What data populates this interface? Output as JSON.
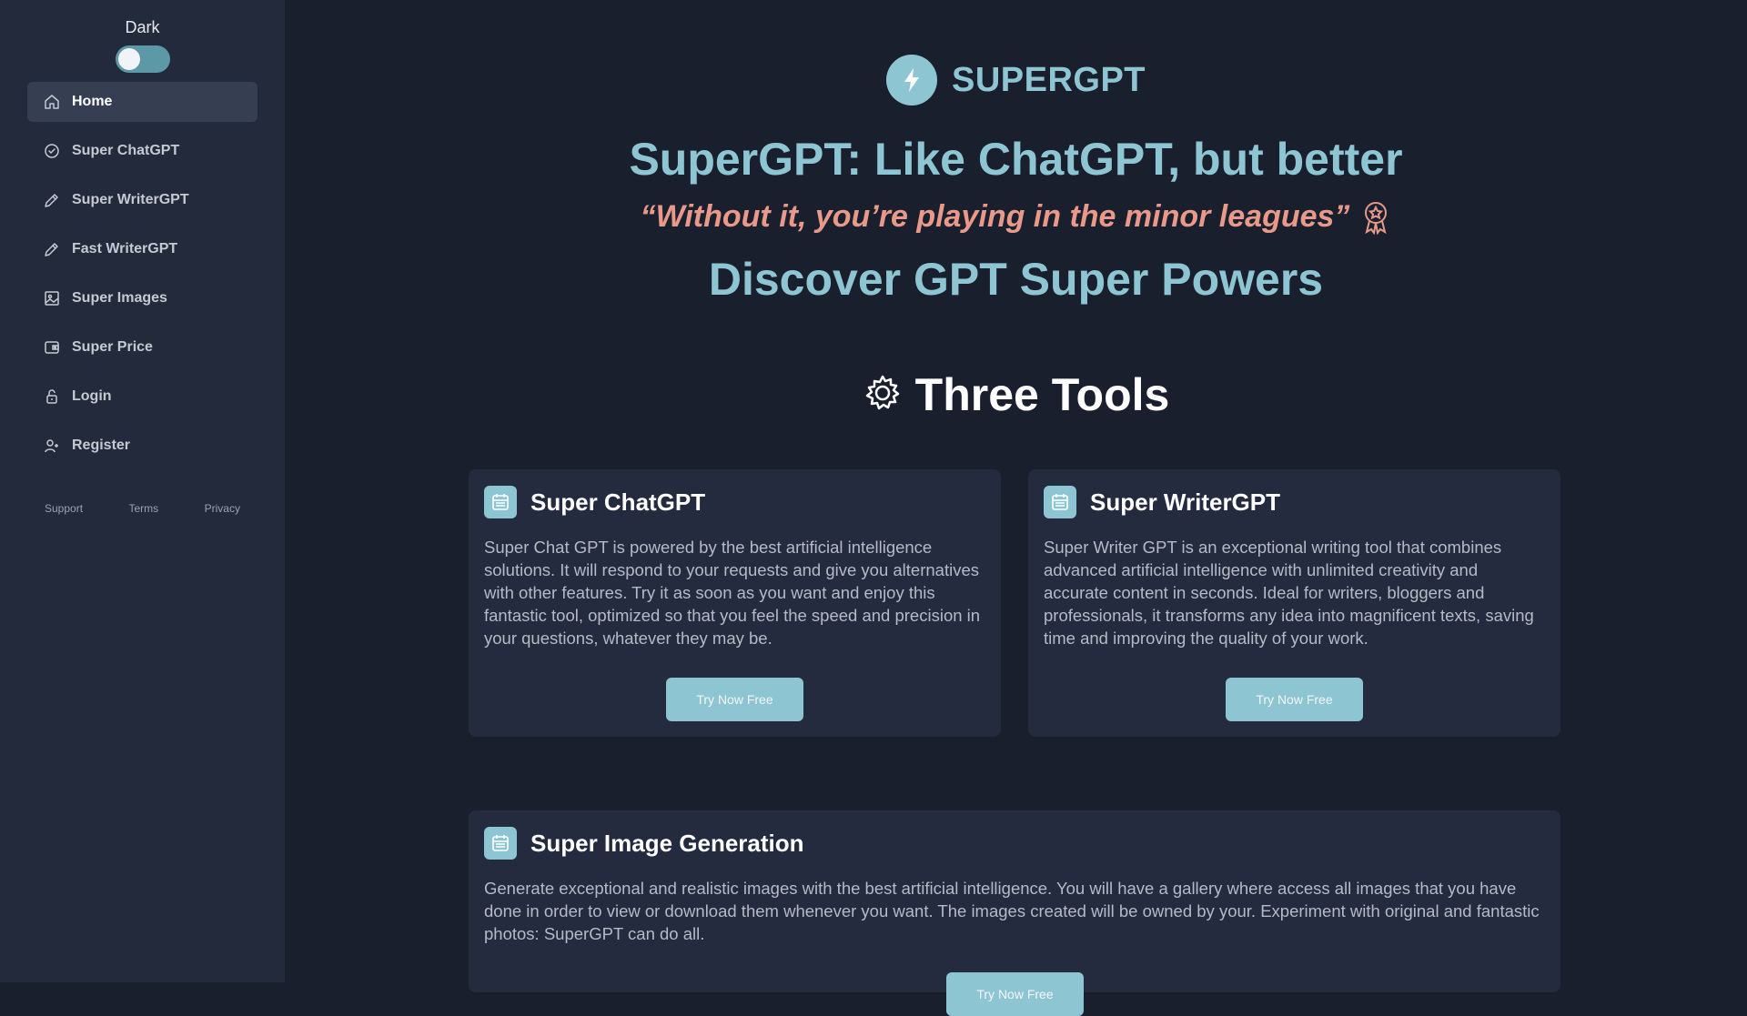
{
  "sidebar": {
    "theme_label": "Dark",
    "items": [
      {
        "label": "Home",
        "icon": "home-icon",
        "active": true
      },
      {
        "label": "Super ChatGPT",
        "icon": "chat-icon"
      },
      {
        "label": "Super WriterGPT",
        "icon": "pencil-icon"
      },
      {
        "label": "Fast WriterGPT",
        "icon": "pencil-icon"
      },
      {
        "label": "Super Images",
        "icon": "image-icon"
      },
      {
        "label": "Super Price",
        "icon": "wallet-icon"
      },
      {
        "label": "Login",
        "icon": "lock-icon"
      },
      {
        "label": "Register",
        "icon": "user-add-icon"
      }
    ],
    "footer": {
      "support": "Support",
      "terms": "Terms",
      "privacy": "Privacy"
    }
  },
  "hero": {
    "brand": "SUPERGPT",
    "headline": "SuperGPT: Like ChatGPT, but better",
    "quote": "“Without it, you’re playing in the minor leagues”",
    "subheadline": "Discover GPT Super Powers"
  },
  "tools": {
    "section_title": "Three Tools",
    "cards": [
      {
        "title": "Super ChatGPT",
        "description": "Super Chat GPT is powered by the best artificial intelligence solutions. It will respond to your requests and give you alternatives with other features. Try it as soon as you want and enjoy this fantastic tool, optimized so that you feel the speed and precision in your questions, whatever they may be.",
        "button": "Try Now Free"
      },
      {
        "title": "Super WriterGPT",
        "description": "Super Writer GPT is an exceptional writing tool that combines advanced artificial intelligence with unlimited creativity and accurate content in seconds. Ideal for writers, bloggers and professionals, it transforms any idea into magnificent texts, saving time and improving the quality of your work.",
        "button": "Try Now Free"
      },
      {
        "title": "Super Image Generation",
        "description": "Generate exceptional and realistic images with the best artificial intelligence. You will have a gallery where access all images that you have done in order to view or download them whenever you want. The images created will be owned by your. Experiment with original and fantastic photos: SuperGPT can do all.",
        "button": "Try Now Free"
      }
    ]
  },
  "colors": {
    "background": "#1a1f2e",
    "sidebar": "#232a3b",
    "accent": "#8ec5d3",
    "quote": "#e8998a",
    "card": "#242b3e"
  }
}
